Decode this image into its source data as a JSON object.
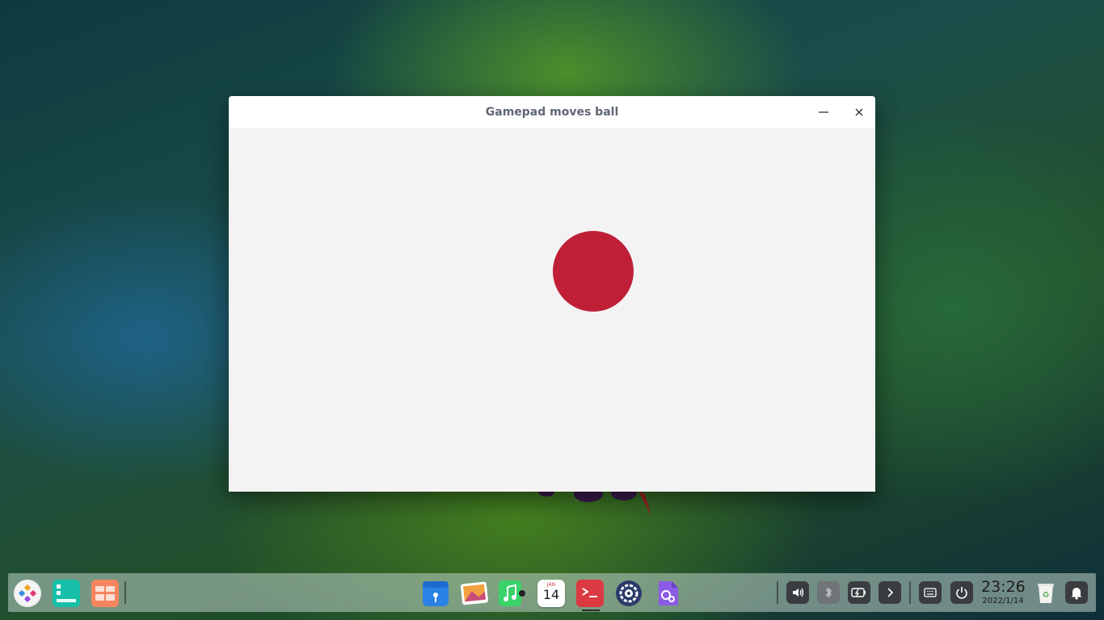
{
  "window": {
    "title": "Gamepad moves ball",
    "minimize_icon": "minimize-icon",
    "close_icon": "close-icon"
  },
  "game": {
    "ball_color": "#c01f38",
    "background_color": "#f3f3f3"
  },
  "dock": {
    "left_apps": [
      {
        "name": "launcher",
        "icon": "launcher-icon"
      },
      {
        "name": "multitasking-view",
        "icon": "multitasking-icon"
      },
      {
        "name": "workspace-switcher",
        "icon": "workspace-icon"
      }
    ],
    "center_apps": [
      {
        "name": "app-store",
        "icon": "app-store-icon"
      },
      {
        "name": "image-viewer",
        "icon": "image-viewer-icon"
      },
      {
        "name": "music",
        "icon": "music-icon"
      },
      {
        "name": "calendar",
        "icon": "calendar-icon"
      },
      {
        "name": "terminal",
        "icon": "terminal-icon",
        "active": true
      },
      {
        "name": "settings",
        "icon": "settings-icon"
      },
      {
        "name": "utilities",
        "icon": "utilities-icon"
      }
    ],
    "calendar": {
      "month": "JAN",
      "day": "14"
    },
    "tray": [
      "volume-icon",
      "bluetooth-icon",
      "battery-icon",
      "expand-icon",
      "keyboard-icon",
      "power-icon"
    ],
    "clock": {
      "time": "23:26",
      "date": "2022/1/14"
    },
    "trash_icon": "trash-icon",
    "notification_icon": "bell-icon"
  }
}
